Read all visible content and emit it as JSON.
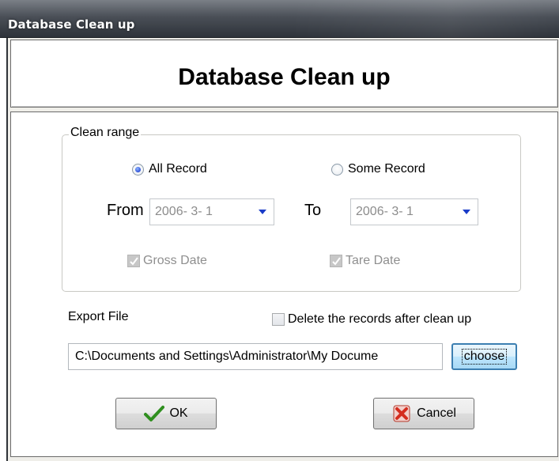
{
  "window": {
    "title": "Database Clean up"
  },
  "header": {
    "heading": "Database Clean up"
  },
  "clean_range": {
    "legend": "Clean range",
    "options": [
      {
        "label": "All Record",
        "checked": true
      },
      {
        "label": "Some Record",
        "checked": false
      }
    ],
    "from_label": "From",
    "from_value": "2006- 3- 1",
    "to_label": "To",
    "to_value": "2006- 3- 1",
    "gross_date_label": "Gross Date",
    "tare_date_label": "Tare Date"
  },
  "export": {
    "label": "Export File",
    "delete_label": "Delete the records after clean up",
    "path_value": "C:\\Documents and Settings\\Administrator\\My Docume",
    "choose_label": "choose"
  },
  "buttons": {
    "ok_label": "OK",
    "cancel_label": "Cancel"
  },
  "icons": {
    "ok": "checkmark-icon",
    "cancel": "red-x-icon",
    "combo": "chevron-down-icon"
  },
  "colors": {
    "accent": "#1a3cc8",
    "check_green": "#2f8f1f",
    "cancel_red": "#d42d1f"
  }
}
